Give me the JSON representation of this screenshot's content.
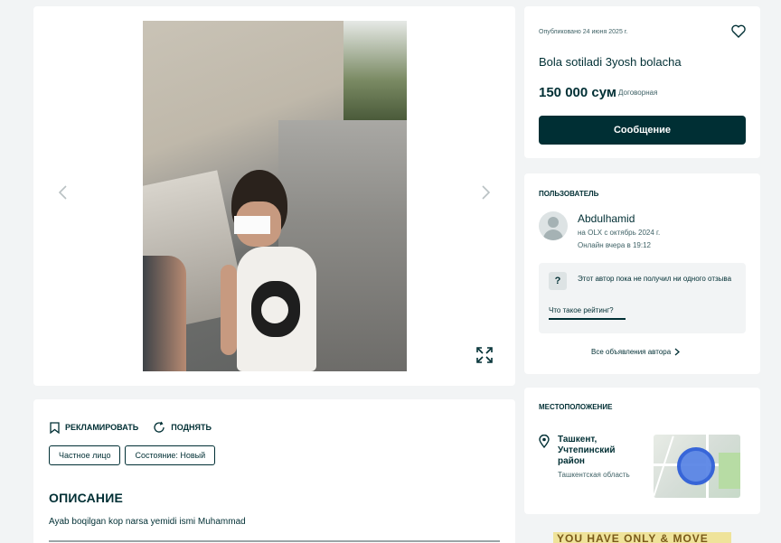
{
  "gallery": {
    "prev_icon": "chevron-left-icon",
    "next_icon": "chevron-right-icon",
    "expand_icon": "expand-icon"
  },
  "details": {
    "actions": [
      {
        "label": "Рекламировать",
        "icon": "bookmark-icon"
      },
      {
        "label": "Поднять",
        "icon": "refresh-icon"
      }
    ],
    "tags": [
      "Частное лицо",
      "Состояние: Новый"
    ],
    "description_title": "ОПИСАНИЕ",
    "description_text": "Ayab boqilgan kop narsa yemidi ismi Muhammad"
  },
  "listing": {
    "published": "Опубликовано 24 июня 2025 г.",
    "title": "Bola sotiladi 3yosh bolacha",
    "price": "150 000 сум",
    "price_note": "Договорная",
    "message_button": "Сообщение"
  },
  "user": {
    "section_title": "Пользователь",
    "name": "Abdulhamid",
    "since": "на OLX с октябрь 2024 г.",
    "online": "Онлайн вчера в 19:12",
    "rating_text": "Этот автор пока не получил ни одного отзыва",
    "rating_link": "Что такое рейтинг?",
    "all_ads": "Все объявления автора"
  },
  "location": {
    "section_title": "Местоположение",
    "city": "Ташкент, Учтепинский район",
    "region": "Ташкентская область"
  },
  "banner": {
    "text": "YOU HAVE ONLY & MOVE"
  },
  "colors": {
    "primary": "#002f34",
    "background": "#f2f4f5",
    "map_marker": "#5b86e6"
  }
}
